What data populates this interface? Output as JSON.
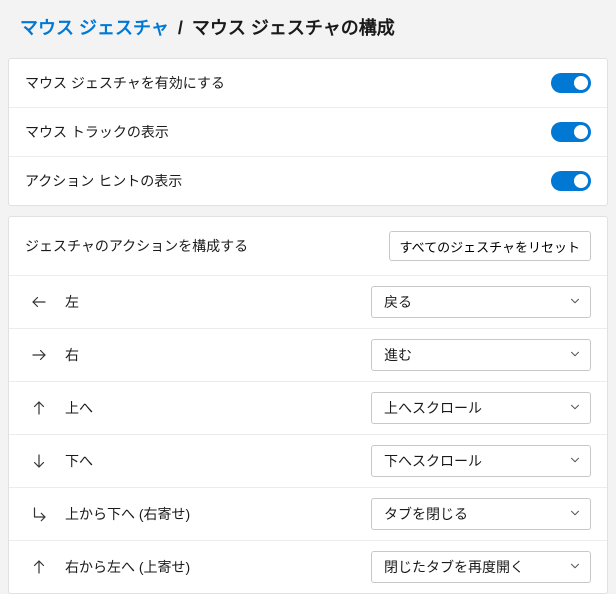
{
  "breadcrumb": {
    "parent": "マウス ジェスチャ",
    "separator": "/",
    "current": "マウス ジェスチャの構成"
  },
  "toggles": [
    {
      "label": "マウス ジェスチャを有効にする",
      "on": true
    },
    {
      "label": "マウス トラックの表示",
      "on": true
    },
    {
      "label": "アクション ヒントの表示",
      "on": true
    }
  ],
  "config": {
    "title": "ジェスチャのアクションを構成する",
    "reset_label": "すべてのジェスチャをリセット"
  },
  "gestures": [
    {
      "icon": "arrow-left",
      "label": "左",
      "action": "戻る"
    },
    {
      "icon": "arrow-right",
      "label": "右",
      "action": "進む"
    },
    {
      "icon": "arrow-up",
      "label": "上へ",
      "action": "上へスクロール"
    },
    {
      "icon": "arrow-down",
      "label": "下へ",
      "action": "下へスクロール"
    },
    {
      "icon": "corner-dr",
      "label": "上から下へ (右寄せ)",
      "action": "タブを閉じる"
    },
    {
      "icon": "arrow-up",
      "label": "右から左へ (上寄せ)",
      "action": "閉じたタブを再度開く"
    }
  ]
}
